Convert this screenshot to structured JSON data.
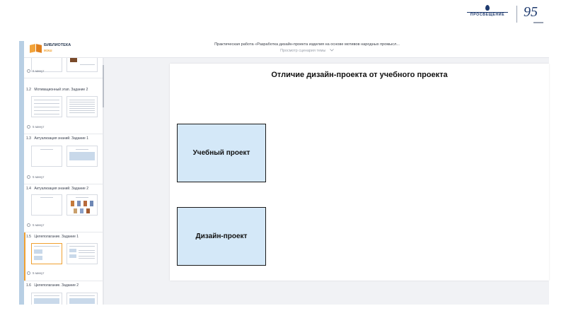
{
  "brand": {
    "publisher": "ПРОСВЕЩЕНИЕ",
    "anniversary": "95"
  },
  "header": {
    "logo_title": "БИБЛИОТЕКА",
    "logo_sub": "МЭШ",
    "work_title": "Практическая работа «Разработка дизайн-проекта изделия на основе мотивов народных промысл...",
    "view_mode": "Просмотр сценария темы"
  },
  "sidebar": {
    "lessons": [
      {
        "number": "",
        "title": "",
        "duration": "5 минут"
      },
      {
        "number": "1.2",
        "title": "Мотивационный этап. Задание 2",
        "duration": "5 минут"
      },
      {
        "number": "1.3",
        "title": "Актуализация знаний. Задание 1",
        "duration": "5 минут"
      },
      {
        "number": "1.4",
        "title": "Актуализация знаний. Задание 2",
        "duration": "5 минут"
      },
      {
        "number": "1.5",
        "title": "Целеполагание. Задание 1",
        "duration": "5 минут"
      },
      {
        "number": "1.6",
        "title": "Целеполагание. Задание 2",
        "duration": ""
      }
    ]
  },
  "slide": {
    "title": "Отличие дизайн-проекта от учебного проекта",
    "box1": "Учебный проект",
    "box2": "Дизайн-проект"
  },
  "colors": {
    "accent": "#f0a030",
    "box_fill": "#d4e8f8",
    "brand_blue": "#1e3a6e"
  },
  "icons": [
    "book-logo-icon",
    "chevron-down-icon",
    "clock-icon"
  ]
}
